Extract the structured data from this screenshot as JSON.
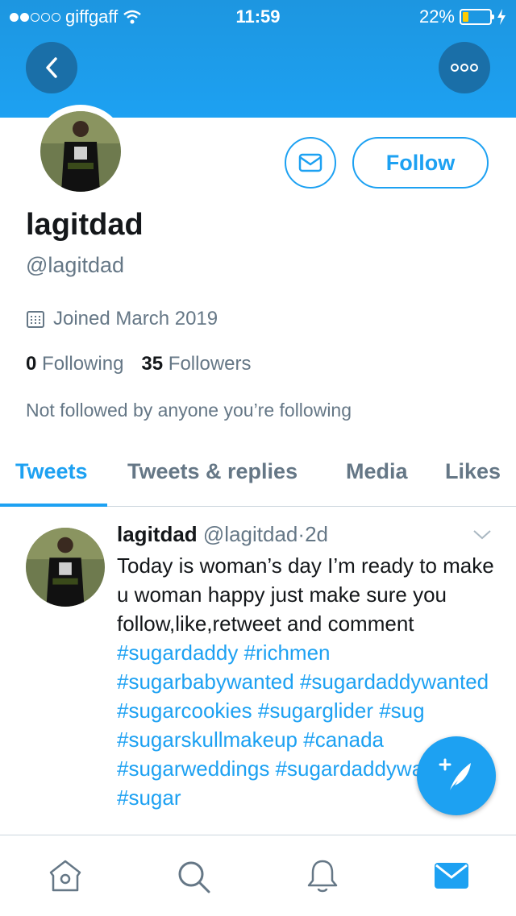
{
  "status_bar": {
    "carrier": "giffgaff",
    "time": "11:59",
    "battery": "22%",
    "battery_level": 0.22
  },
  "header": {
    "back_icon": "chevron-left-icon",
    "more_icon": "more-dots-icon",
    "brand_color": "#1da1f2"
  },
  "profile": {
    "display_name": "lagitdad",
    "handle": "@lagitdad",
    "joined": "Joined March 2019",
    "following_count": "0",
    "following_label": "Following",
    "followers_count": "35",
    "followers_label": "Followers",
    "not_followed": "Not followed by anyone you’re following",
    "follow_label": "Follow",
    "message_icon": "envelope-icon"
  },
  "tabs": [
    {
      "label": "Tweets",
      "active": true
    },
    {
      "label": "Tweets & replies",
      "active": false
    },
    {
      "label": "Media",
      "active": false
    },
    {
      "label": "Likes",
      "active": false
    }
  ],
  "tweet": {
    "name": "lagitdad",
    "handle": "@lagitdad",
    "separator": "·",
    "time": "2d",
    "text": "Today is woman’s day I’m ready to make u woman happy just make sure you follow,like,retweet and comment",
    "hashtags": [
      "#sugardaddy",
      "#richmen",
      "#sugarbabywanted",
      "#sugardaddywanted",
      "#sugarcookies",
      "#sugarglider",
      "#sug",
      "#sugarskullmakeup",
      "#canada",
      "#sugarweddings",
      "#sugardaddywanted",
      "#sugar"
    ]
  },
  "compose_icon": "compose-tweet-icon",
  "tabbar": {
    "items": [
      "home-icon",
      "search-icon",
      "notifications-icon",
      "messages-icon"
    ],
    "active": "messages-icon"
  }
}
